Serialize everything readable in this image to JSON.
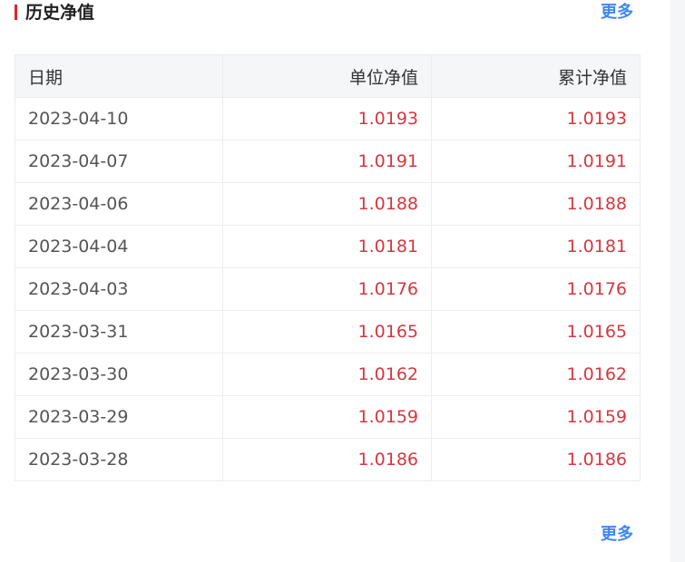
{
  "section": {
    "title": "历史净值",
    "more_label": "更多",
    "accent_color": "#e02433",
    "link_color": "#3f86f5",
    "value_color": "#d6373f"
  },
  "table": {
    "columns": [
      "日期",
      "单位净值",
      "累计净值"
    ],
    "rows": [
      {
        "date": "2023-04-10",
        "unit_nav": "1.0193",
        "cumulative_nav": "1.0193"
      },
      {
        "date": "2023-04-07",
        "unit_nav": "1.0191",
        "cumulative_nav": "1.0191"
      },
      {
        "date": "2023-04-06",
        "unit_nav": "1.0188",
        "cumulative_nav": "1.0188"
      },
      {
        "date": "2023-04-04",
        "unit_nav": "1.0181",
        "cumulative_nav": "1.0181"
      },
      {
        "date": "2023-04-03",
        "unit_nav": "1.0176",
        "cumulative_nav": "1.0176"
      },
      {
        "date": "2023-03-31",
        "unit_nav": "1.0165",
        "cumulative_nav": "1.0165"
      },
      {
        "date": "2023-03-30",
        "unit_nav": "1.0162",
        "cumulative_nav": "1.0162"
      },
      {
        "date": "2023-03-29",
        "unit_nav": "1.0159",
        "cumulative_nav": "1.0159"
      },
      {
        "date": "2023-03-28",
        "unit_nav": "1.0186",
        "cumulative_nav": "1.0186"
      }
    ]
  }
}
